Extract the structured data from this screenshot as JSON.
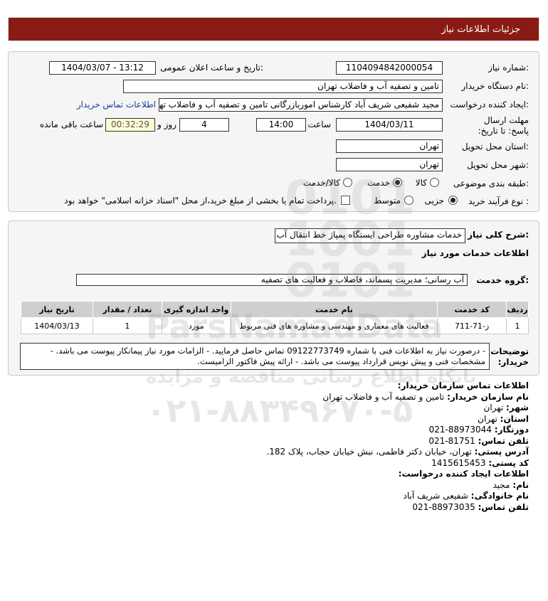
{
  "header": {
    "title": "جزئیات اطلاعات نیاز"
  },
  "form": {
    "need_number_label": "شماره نیاز:",
    "need_number": "1104094842000054",
    "announce_label": "تاریخ و ساعت اعلان عمومی:",
    "announce_value": "1404/03/07 - 13:12",
    "buyer_org_label": "نام دستگاه خریدار:",
    "buyer_org": "تامین و تصفیه آب و فاضلاب تهران",
    "creator_label": "ایجاد کننده درخواست:",
    "creator": "مجید شفیعی شریف آباد کارشناس اموربازرگانی تامین و تصفیه آب و فاضلاب تهر",
    "contact_link": "اطلاعات تماس خریدار",
    "deadline_label": "مهلت ارسال پاسخ: تا تاریخ:",
    "deadline_date": "1404/03/11",
    "time_label": "ساعت",
    "deadline_time": "14:00",
    "days": "4",
    "days_label": "روز و",
    "remaining_time": "00:32:29",
    "remaining_label": "ساعت باقی مانده",
    "province_label": "استان محل تحویل:",
    "province": "تهران",
    "city_label": "شهر محل تحویل:",
    "city": "تهران",
    "category_label": "طبقه بندی موضوعی:",
    "category_options": [
      "کالا",
      "خدمت",
      "کالا/خدمت"
    ],
    "category_selected": "خدمت",
    "process_label": "نوع فرآیند خرید :",
    "process_options": [
      "جزیی",
      "متوسط"
    ],
    "process_selected": "جزیی",
    "payment_note": "پرداخت تمام یا بخشی از مبلغ خرید،از محل \"اسناد خزانه اسلامی\" خواهد بود."
  },
  "details": {
    "summary_label": "شرح کلی نیاز:",
    "summary": "خدمات مشاوره طراحی ایستگاه پمپاژ خط انتقال آب",
    "services_title": "اطلاعات خدمات مورد نیاز",
    "group_label": "گروه خدمت:",
    "group_value": "آب رسانی؛ مدیریت پسماند، فاضلاب و فعالیت های تصفیه",
    "table": {
      "headers": [
        "ردیف",
        "کد خدمت",
        "نام خدمت",
        "واحد اندازه گیری",
        "تعداد / مقدار",
        "تاریخ نیاز"
      ],
      "rows": [
        [
          "1",
          "ز-71-711",
          "فعالیت های معماری و مهندسی و مشاوره های فنی مربوط",
          "مورد",
          "1",
          "1404/03/13"
        ]
      ]
    },
    "notes_label": "توضیحات خریدار:",
    "notes": "- درصورت نیاز به اطلاعات فنی با شماره 09122773749 تماس حاصل فرمایید. - الزامات مورد نیاز پیمانکار پیوست می باشد. - مشخصات فنی و پیش نویس قرارداد پیوست می باشد. - ارائه پیش فاکتور الزامیست."
  },
  "contact": {
    "title": "اطلاعات تماس سازمان خریدار:",
    "org_label": "نام سازمان خریدار:",
    "org": "تامین و تصفیه آب و فاضلاب تهران",
    "city_label": "شهر:",
    "city": "تهران",
    "province_label": "استان:",
    "province": "تهران",
    "fax_label": "دورنگار:",
    "fax": "021-88973044",
    "phone_label": "تلفن تماس:",
    "phone": "021-81751",
    "address_label": "آدرس پستی:",
    "address": "تهران، خیابان دکتر فاطمی، نبش خیابان حجاب، پلاک 182.",
    "postal_label": "کد پستی:",
    "postal": "1415615453",
    "creator_title": "اطلاعات ایجاد کننده درخواست:",
    "name_label": "نام:",
    "name": "مجید",
    "family_label": "نام خانوادگی:",
    "family": "شفیعی شریف آباد",
    "creator_phone_label": "تلفن تماس:",
    "creator_phone": "021-88973035"
  },
  "watermark": {
    "brand": "ParsNamadData",
    "line1": "پایگاه اطلاع رسانی مناقصه و مزایده",
    "line2": "۰۲۱-۸۸۳۴۹۶۷۰-۵"
  }
}
